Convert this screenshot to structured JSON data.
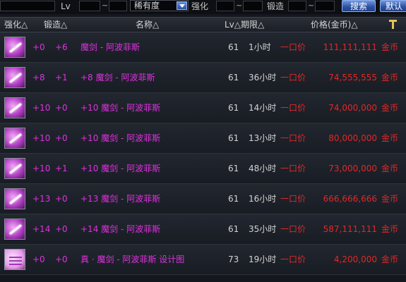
{
  "filter": {
    "lv_label": "Lv",
    "tilde": "~",
    "rarity_value": "稀有度",
    "enhance_label": "强化",
    "forge_label": "锻造",
    "search_label": "搜索",
    "default_label": "默认"
  },
  "header": {
    "enhance": "强化△",
    "forge": "锻造△",
    "name": "名称△",
    "lv_period": "Lv△期限△",
    "price": "价格(金币)△"
  },
  "rows": [
    {
      "enhance": "+0",
      "forge": "+6",
      "name": "魔剑 - 阿波菲斯",
      "lv": "61",
      "period": "1小时",
      "sale_type": "一口价",
      "price": "111,111,111",
      "currency": "金币",
      "icon": "sword-icon"
    },
    {
      "enhance": "+8",
      "forge": "+1",
      "name": "+8 魔剑 - 阿波菲斯",
      "lv": "61",
      "period": "36小时",
      "sale_type": "一口价",
      "price": "74,555,555",
      "currency": "金币",
      "icon": "sword-icon"
    },
    {
      "enhance": "+10",
      "forge": "+0",
      "name": "+10 魔剑 - 阿波菲斯",
      "lv": "61",
      "period": "14小时",
      "sale_type": "一口价",
      "price": "74,000,000",
      "currency": "金币",
      "icon": "sword-icon"
    },
    {
      "enhance": "+10",
      "forge": "+0",
      "name": "+10 魔剑 - 阿波菲斯",
      "lv": "61",
      "period": "13小时",
      "sale_type": "一口价",
      "price": "80,000,000",
      "currency": "金币",
      "icon": "sword-icon"
    },
    {
      "enhance": "+10",
      "forge": "+1",
      "name": "+10 魔剑 - 阿波菲斯",
      "lv": "61",
      "period": "48小时",
      "sale_type": "一口价",
      "price": "73,000,000",
      "currency": "金币",
      "icon": "sword-icon"
    },
    {
      "enhance": "+13",
      "forge": "+0",
      "name": "+13 魔剑 - 阿波菲斯",
      "lv": "61",
      "period": "16小时",
      "sale_type": "一口价",
      "price": "666,666,666",
      "currency": "金币",
      "icon": "sword-icon"
    },
    {
      "enhance": "+14",
      "forge": "+0",
      "name": "+14 魔剑 - 阿波菲斯",
      "lv": "61",
      "period": "35小时",
      "sale_type": "一口价",
      "price": "587,111,111",
      "currency": "金币",
      "icon": "sword-icon"
    },
    {
      "enhance": "+0",
      "forge": "+0",
      "name": "真 · 魔剑 - 阿波菲斯  设计图",
      "lv": "73",
      "period": "19小时",
      "sale_type": "一口价",
      "price": "4,200,000",
      "currency": "金币",
      "icon": "scroll-icon"
    }
  ]
}
